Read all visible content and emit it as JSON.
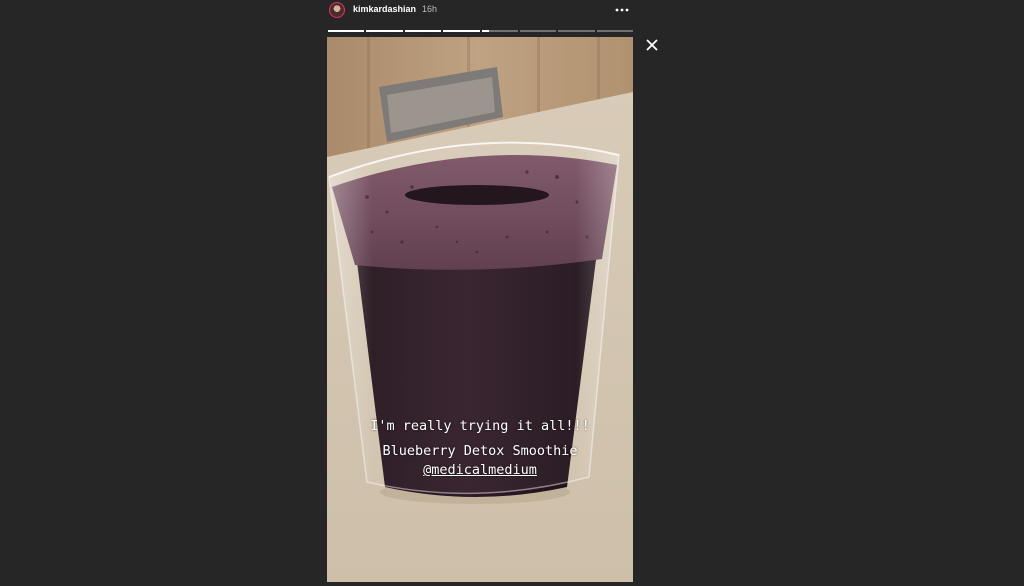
{
  "header": {
    "username": "kimkardashian",
    "time_ago": "16h",
    "more_icon": "more-horizontal-icon",
    "avatar": "avatar"
  },
  "progress": {
    "segments": 8,
    "completed_segments": 4,
    "current_segment_progress": 0.2
  },
  "close_icon": "close-icon",
  "story": {
    "caption_line_1": "I'm really trying it all!!!",
    "caption_line_2": "Blueberry Detox Smoothie",
    "mention": "@medicalmedium"
  },
  "colors": {
    "background": "#262626",
    "text": "#ffffff",
    "smoothie": "#2a1620",
    "foam": "#6a4556"
  }
}
